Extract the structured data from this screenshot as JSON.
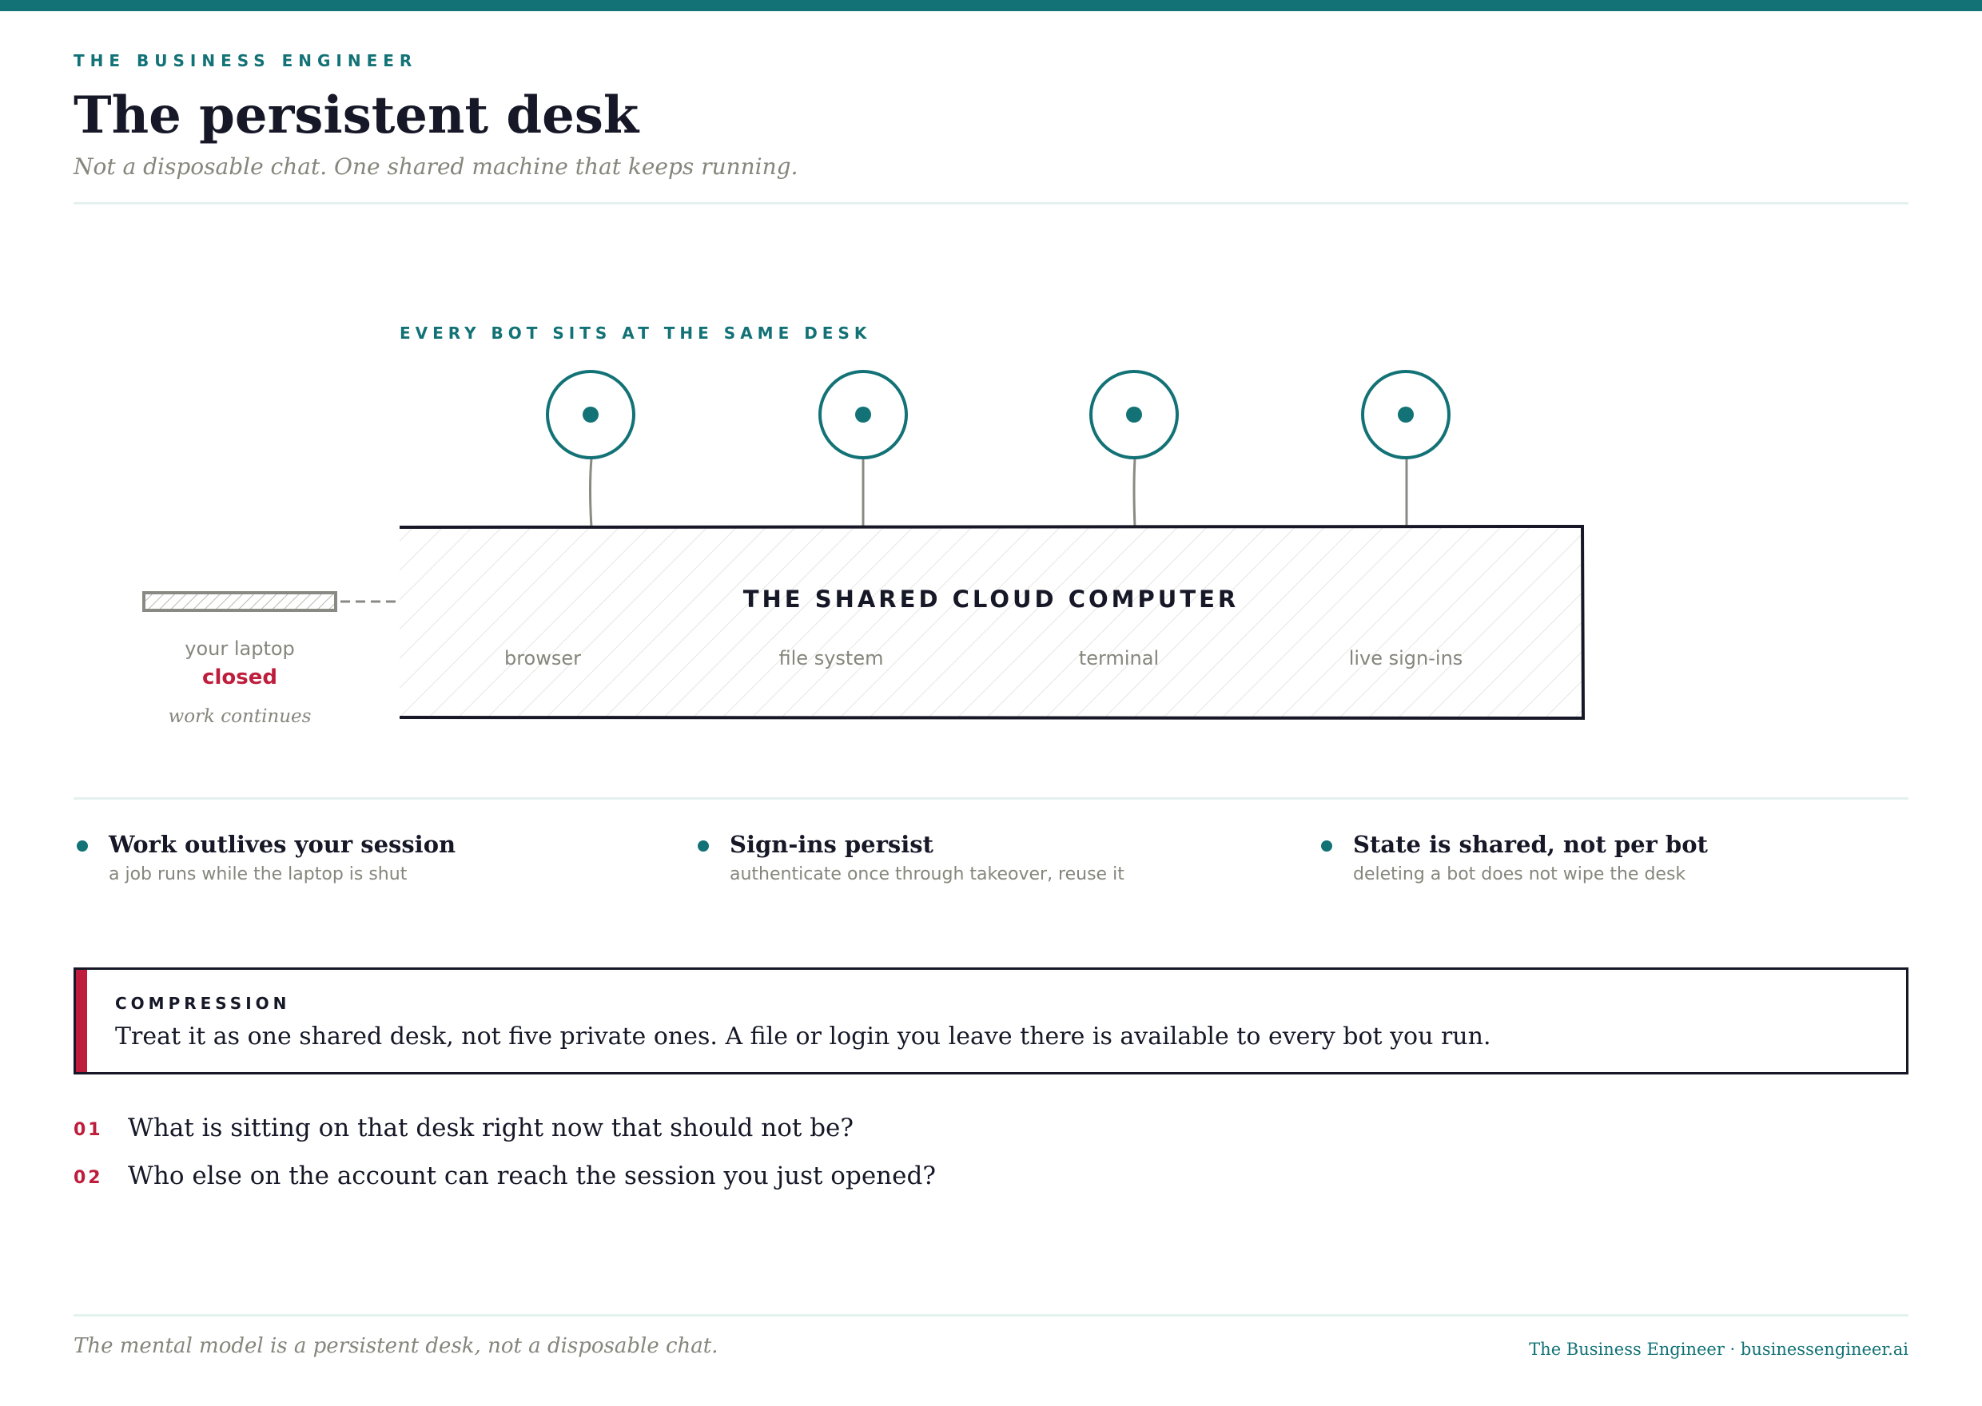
{
  "header": {
    "kicker": "THE BUSINESS ENGINEER",
    "title": "The persistent desk",
    "subtitle": "Not a disposable chat. One shared machine that keeps running."
  },
  "diagram": {
    "section_label": "EVERY BOT SITS AT THE SAME DESK",
    "bots": [
      {
        "icon": "bot-circle-icon"
      },
      {
        "icon": "bot-circle-icon"
      },
      {
        "icon": "bot-circle-icon"
      },
      {
        "icon": "bot-circle-icon"
      }
    ],
    "computer": {
      "title": "THE SHARED CLOUD COMPUTER",
      "components": [
        "browser",
        "file system",
        "terminal",
        "live sign-ins"
      ]
    },
    "laptop": {
      "label": "your laptop",
      "state": "closed",
      "note": "work continues"
    }
  },
  "points": [
    {
      "title": "Work outlives your session",
      "desc": "a job runs while the laptop is shut"
    },
    {
      "title": "Sign-ins persist",
      "desc": "authenticate once through takeover, reuse it"
    },
    {
      "title": "State is shared, not per bot",
      "desc": "deleting a bot does not wipe the desk"
    }
  ],
  "callout": {
    "label": "COMPRESSION",
    "text": "Treat it as one shared desk, not five private ones. A file or login you leave there is available to every bot you run."
  },
  "questions": [
    {
      "num": "01",
      "text": "What is sitting on that desk right now that should not be?"
    },
    {
      "num": "02",
      "text": "Who else on the account can reach the session you just opened?"
    }
  ],
  "footer": {
    "left": "The mental model is a persistent desk, not a disposable chat.",
    "right": "The Business Engineer · businessengineer.ai"
  },
  "colors": {
    "accent_teal": "#127276",
    "accent_red": "#be1e3c",
    "ink": "#161827",
    "muted": "#85867c",
    "rule": "#e3f1ef"
  }
}
